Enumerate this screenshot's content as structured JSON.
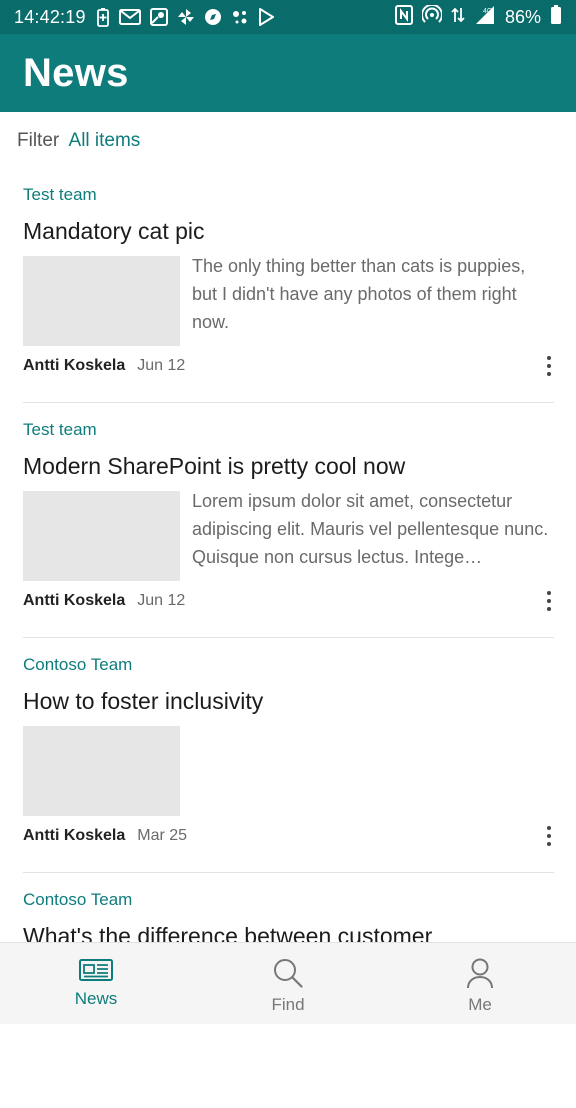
{
  "status_bar": {
    "time": "14:42:19",
    "battery_percent": "86%",
    "network": "4G"
  },
  "app_bar": {
    "title": "News"
  },
  "filter": {
    "label": "Filter",
    "value": "All items"
  },
  "news": [
    {
      "site": "Test team",
      "title": "Mandatory cat pic",
      "summary": "The only thing better than cats is puppies, but I didn't have any photos of them right now.",
      "author": "Antti Koskela",
      "date": "Jun 12"
    },
    {
      "site": "Test team",
      "title": "Modern SharePoint is pretty cool now",
      "summary": "Lorem ipsum dolor sit amet, consectetur adipiscing elit. Mauris vel pellentesque nunc. Quisque non cursus lectus. Intege…",
      "author": "Antti Koskela",
      "date": "Jun 12"
    },
    {
      "site": "Contoso Team",
      "title": "How to foster inclusivity",
      "summary": "",
      "author": "Antti Koskela",
      "date": "Mar 25"
    },
    {
      "site": "Contoso Team",
      "title": "What's the difference between customer",
      "summary": "",
      "author": "",
      "date": ""
    }
  ],
  "bottom_nav": {
    "items": [
      {
        "label": "News",
        "icon": "news-icon",
        "active": true
      },
      {
        "label": "Find",
        "icon": "search-icon",
        "active": false
      },
      {
        "label": "Me",
        "icon": "person-icon",
        "active": false
      }
    ]
  },
  "colors": {
    "accent": "#0f7c7c",
    "status_bar": "#0a6b6b",
    "thumbnail_placeholder": "#e6e6e6"
  }
}
